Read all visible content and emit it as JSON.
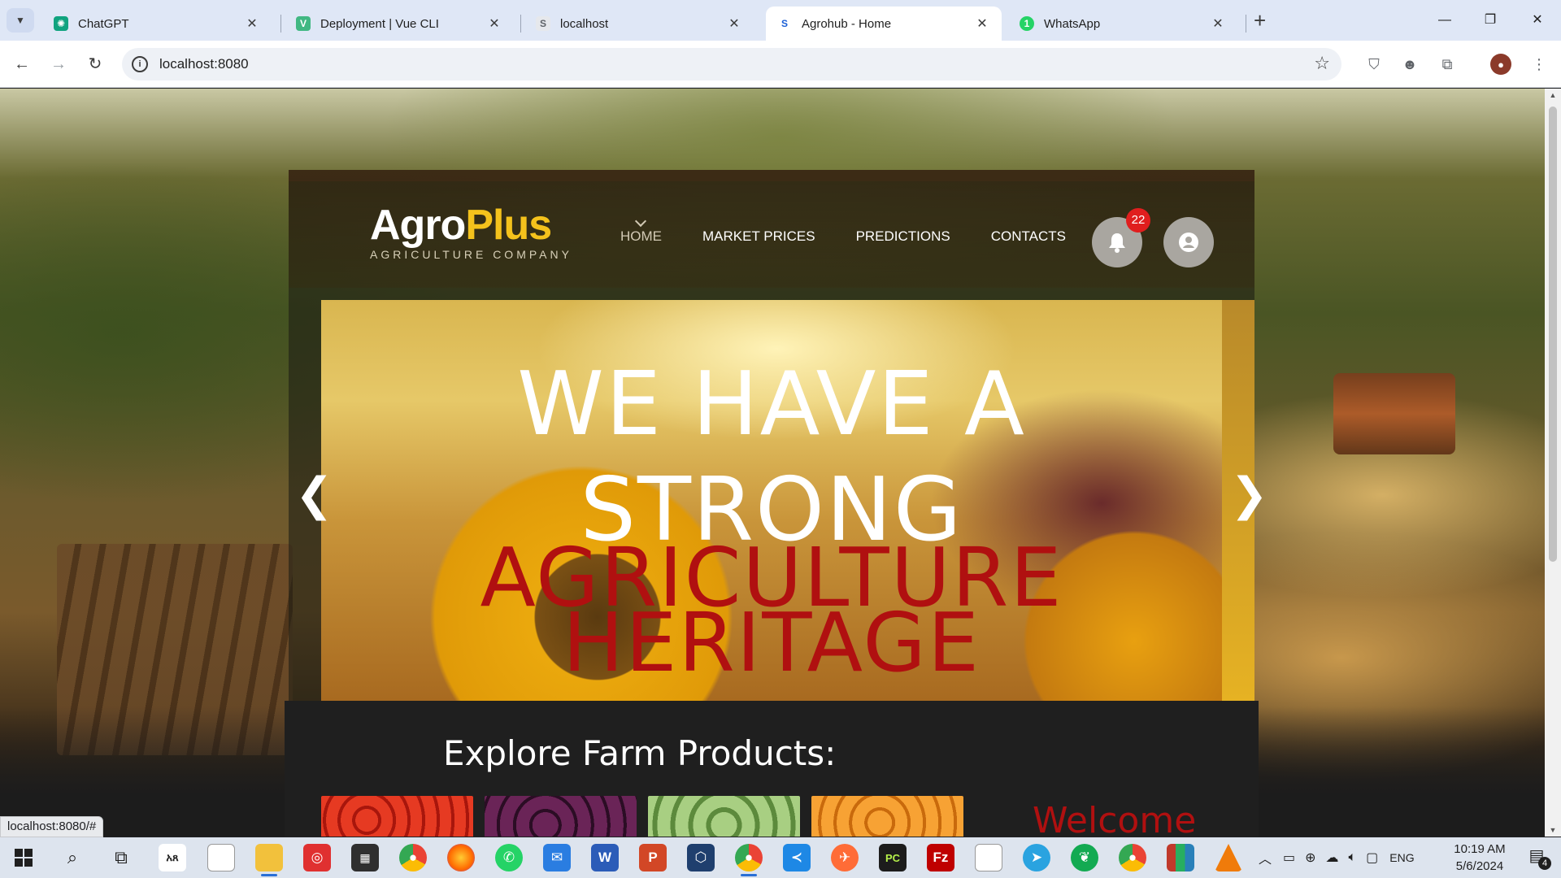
{
  "browser": {
    "tabs": [
      {
        "title": "ChatGPT",
        "icon": "chatgpt-icon",
        "icon_color": "#10a37f"
      },
      {
        "title": "Deployment | Vue CLI",
        "icon": "vue-icon",
        "icon_color": "#41b883"
      },
      {
        "title": "localhost",
        "icon": "page-icon",
        "icon_color": "#5f6368"
      },
      {
        "title": "Agrohub - Home",
        "icon": "agrohub-icon",
        "icon_color": "#1a5fd6",
        "active": true
      },
      {
        "title": "WhatsApp",
        "icon": "whatsapp-icon",
        "icon_color": "#25d366"
      }
    ],
    "url": "localhost:8080",
    "status_url": "localhost:8080/#"
  },
  "site": {
    "logo": {
      "word1": "Agro",
      "word2": "Plus",
      "subtitle": "AGRICULTURE COMPANY"
    },
    "nav": [
      "HOME",
      "MARKET PRICES",
      "PREDICTIONS",
      "CONTACTS"
    ],
    "notification_count": "22",
    "slide": {
      "line1a": "WE HAVE A",
      "line1b": "STRONG",
      "line2a": "AGRICULTURE",
      "line2b": "HERITAGE"
    },
    "prev_arrow": "❮",
    "next_arrow": "❯",
    "explore_title": "Explore Farm Products:",
    "welcome": "Welcome",
    "product_colors": [
      "#d52a1a",
      "#5a1f4a",
      "#7eac5a",
      "#f08a16"
    ]
  },
  "taskbar": {
    "clock_time": "10:19 AM",
    "clock_date": "5/6/2024",
    "language": "ENG",
    "notification_count": "4",
    "apps": [
      "start-icon",
      "search-icon",
      "task-view-icon",
      "amharic-keyboard-icon",
      "notepad-icon",
      "file-explorer-icon",
      "screen-recorder-icon",
      "calculator-icon",
      "chrome-icon",
      "firefox-icon",
      "whatsapp-icon",
      "mail-icon",
      "word-icon",
      "powerpoint-icon",
      "virtualbox-icon",
      "chrome-active-icon",
      "vscode-icon",
      "postman-icon",
      "pycharm-icon",
      "filezilla-icon",
      "file-icon",
      "telegram-icon",
      "mongodb-icon",
      "chrome-profile-icon",
      "winrar-icon",
      "vlc-icon"
    ]
  }
}
